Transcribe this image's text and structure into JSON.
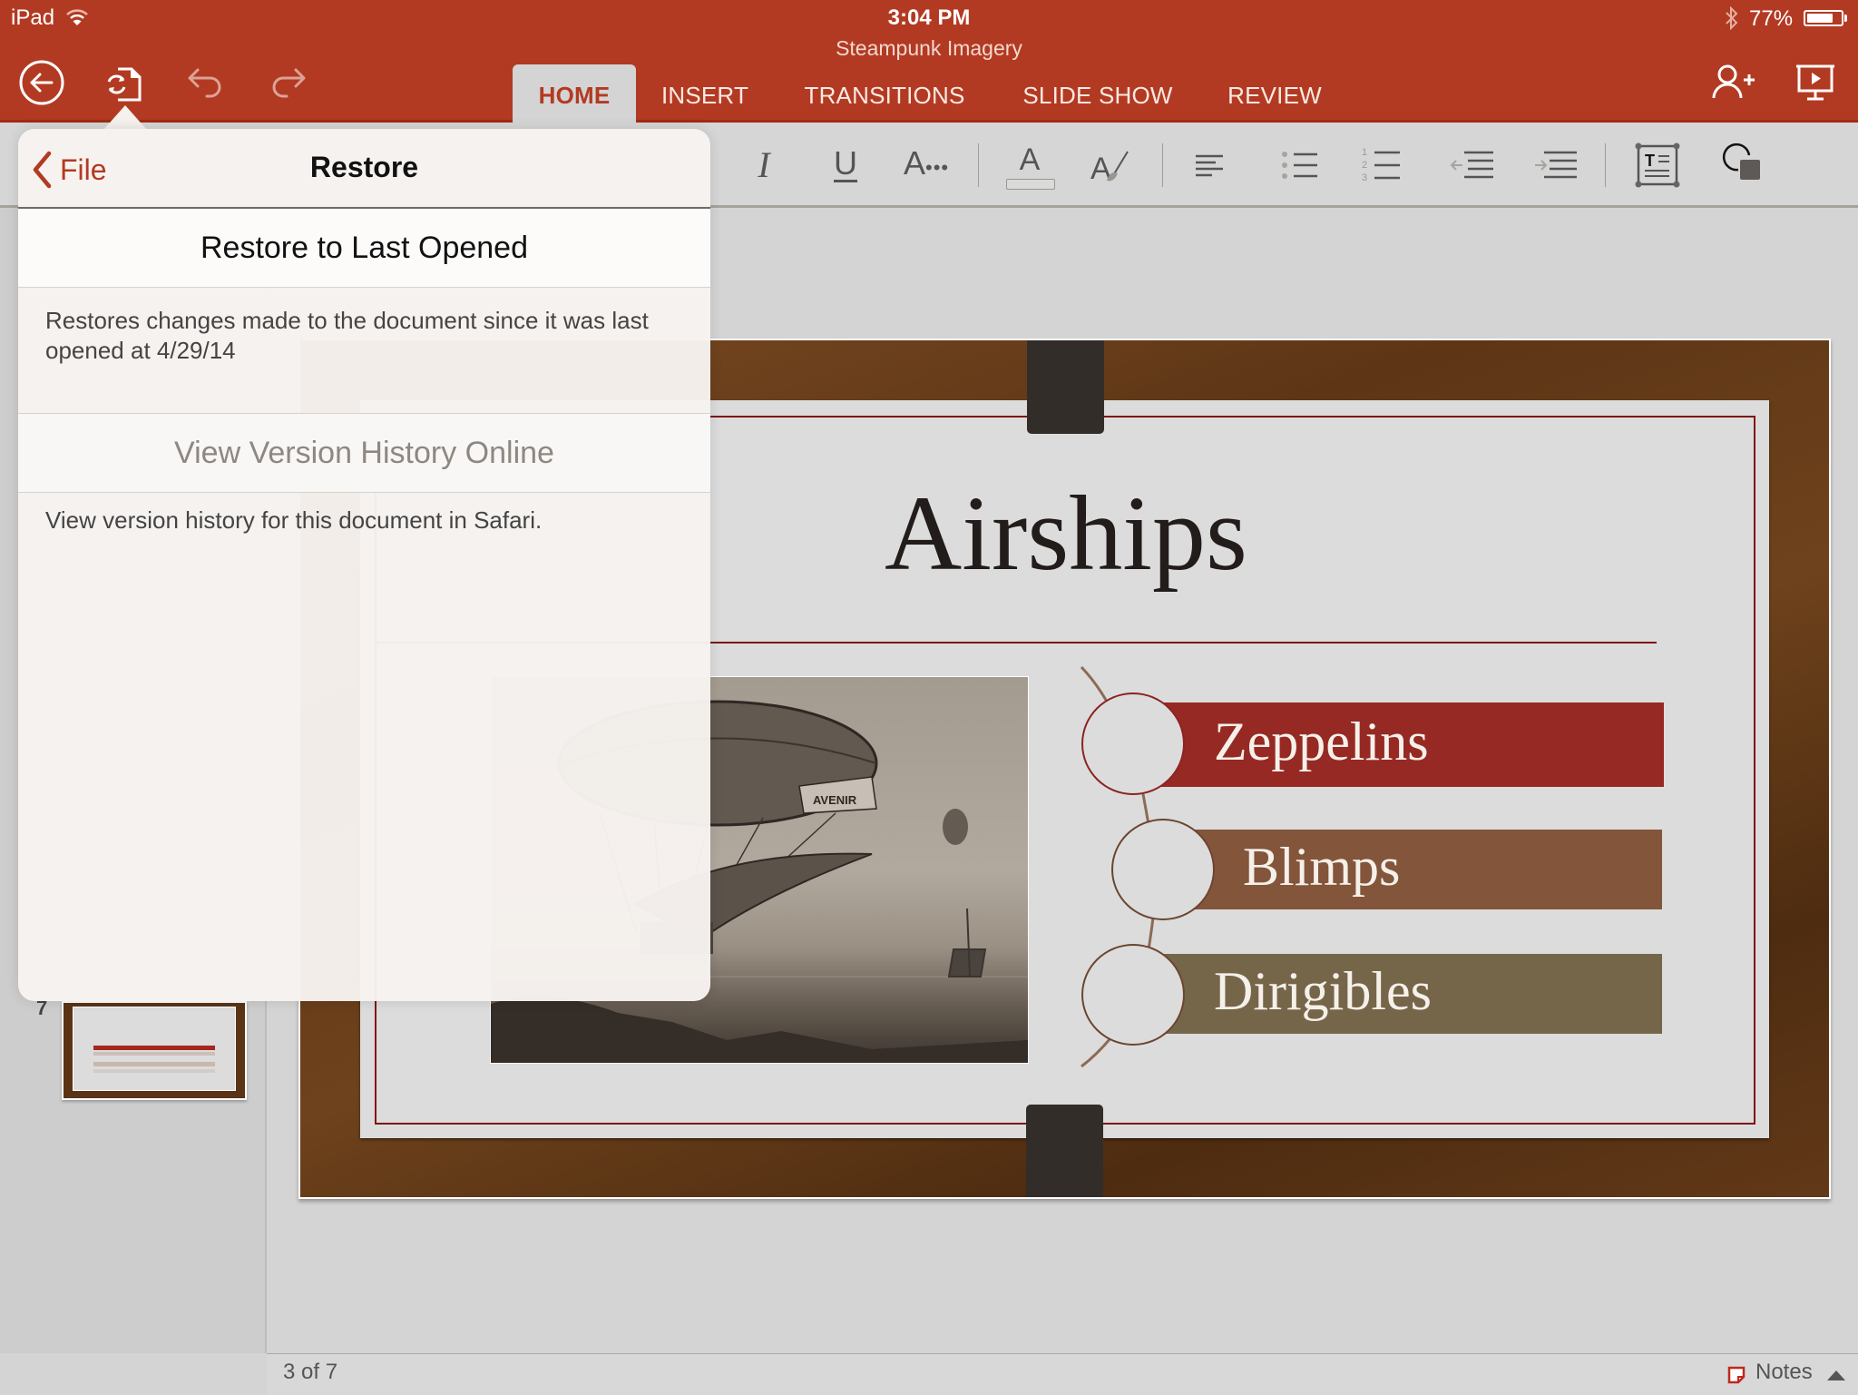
{
  "status_bar": {
    "carrier": "iPad",
    "time": "3:04 PM",
    "battery_percent_label": "77%",
    "battery_level": 0.77,
    "icons": [
      "wifi-icon",
      "bluetooth-icon",
      "battery-icon"
    ]
  },
  "app": {
    "document_title": "Steampunk Imagery",
    "toolbar_icons": [
      "back-icon",
      "file-restore-icon",
      "undo-icon",
      "redo-icon",
      "share-person-add-icon",
      "present-icon"
    ],
    "tabs": [
      {
        "label": "HOME",
        "active": true
      },
      {
        "label": "INSERT",
        "active": false
      },
      {
        "label": "TRANSITIONS",
        "active": false
      },
      {
        "label": "SLIDE SHOW",
        "active": false
      },
      {
        "label": "REVIEW",
        "active": false
      }
    ],
    "accent_color": "#b33a22"
  },
  "ribbon": {
    "tools": [
      "italic-icon",
      "underline-icon",
      "more-font-options-icon",
      "font-color-icon",
      "format-painter-icon",
      "align-left-icon",
      "bullets-icon",
      "numbering-icon",
      "decrease-indent-icon",
      "increase-indent-icon",
      "text-box-icon",
      "shapes-icon"
    ],
    "italic_glyph": "I",
    "underline_glyph": "U",
    "font_glyph": "A",
    "numbering_digits": [
      "1",
      "2",
      "3"
    ],
    "textbox_glyph": "T"
  },
  "thumbnails": {
    "visible_number": "7"
  },
  "popover": {
    "back_label": "File",
    "title": "Restore",
    "restore_button": "Restore to Last Opened",
    "restore_description": "Restores changes made to the document since it was last opened at 4/29/14",
    "history_button": "View Version History Online",
    "history_description": "View version history for this document in Safari."
  },
  "slide": {
    "title": "Airships",
    "image_caption_text": "AVENIR",
    "items": [
      {
        "label": "Zeppelins",
        "color": "#962923"
      },
      {
        "label": "Blimps",
        "color": "#83553a"
      },
      {
        "label": "Dirigibles",
        "color": "#766649"
      }
    ]
  },
  "footer": {
    "slide_counter": "3 of 7",
    "notes_label": "Notes"
  }
}
